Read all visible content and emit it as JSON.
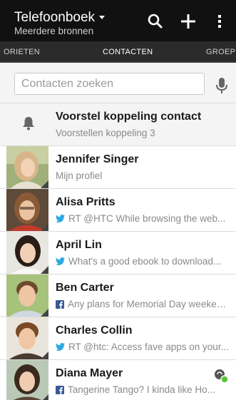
{
  "topbar": {
    "title": "Telefoonboek",
    "subtitle": "Meerdere bronnen",
    "icons": [
      "search-icon",
      "plus-icon",
      "more-icon"
    ]
  },
  "tabs": {
    "left": "ORIETEN",
    "center": "CONTACTEN",
    "right": "GROEPEN"
  },
  "search": {
    "placeholder": "Contacten zoeken",
    "icon": "mic-icon"
  },
  "suggestion": {
    "title": "Voorstel koppeling contact",
    "subtitle": "Voorstellen koppeling 3",
    "icon": "bell-icon"
  },
  "contacts": [
    {
      "name": "Jennifer Singer",
      "status": "Mijn profiel",
      "source": ""
    },
    {
      "name": "Alisa Pritts",
      "status": "RT @HTC While browsing the web...",
      "source": "twitter-icon"
    },
    {
      "name": "April Lin",
      "status": "What's a good ebook to download...",
      "source": "twitter-icon"
    },
    {
      "name": "Ben Carter",
      "status": "Any plans for Memorial Day weekend...",
      "source": "facebook-icon"
    },
    {
      "name": "Charles Collin",
      "status": "RT @htc: Access fave apps on your...",
      "source": "twitter-icon"
    },
    {
      "name": "Diana Mayer",
      "status": "Tangerine Tango? I kinda like Ho...",
      "source": "facebook-icon"
    }
  ],
  "colors": {
    "topbar": "#111111",
    "tabs": "#2b2b2b",
    "twitter": "#2aa9e0",
    "facebook": "#3b5998",
    "presence": "#5cc33a"
  }
}
